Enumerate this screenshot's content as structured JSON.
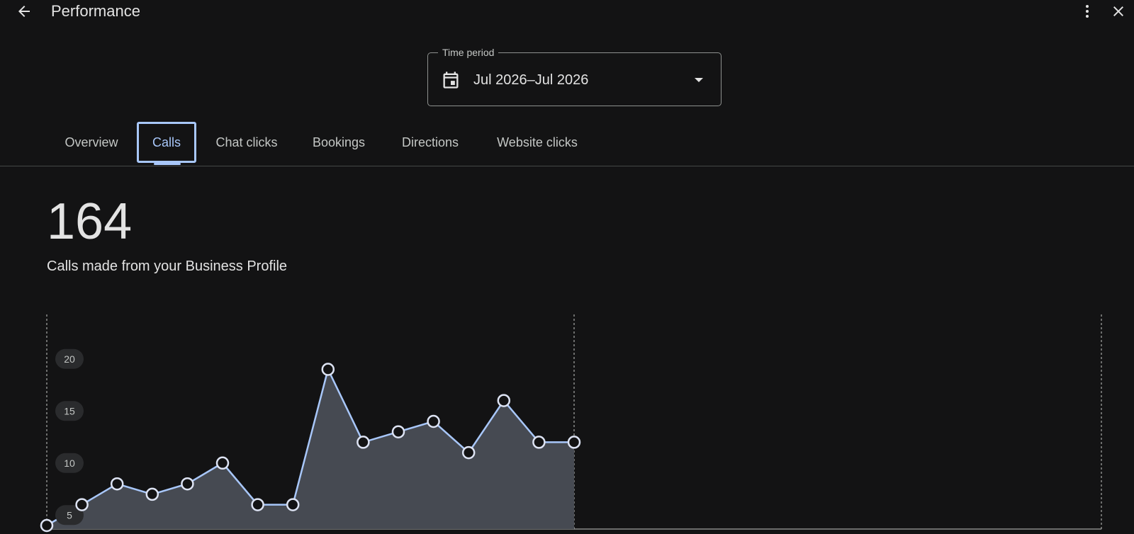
{
  "header": {
    "title": "Performance",
    "back_icon": "arrow-back-icon",
    "more_icon": "more-vert-icon",
    "close_icon": "close-icon"
  },
  "time_period": {
    "label": "Time period",
    "value": "Jul 2026–Jul 2026",
    "icon": "calendar-icon"
  },
  "tabs": [
    {
      "label": "Overview",
      "active": false
    },
    {
      "label": "Calls",
      "active": true
    },
    {
      "label": "Chat clicks",
      "active": false
    },
    {
      "label": "Bookings",
      "active": false
    },
    {
      "label": "Directions",
      "active": false
    },
    {
      "label": "Website clicks",
      "active": false
    }
  ],
  "metric": {
    "count": "164",
    "description": "Calls made from your Business Profile"
  },
  "colors": {
    "background": "#131314",
    "accent": "#a8c7fa",
    "area_fill": "#464a52",
    "text": "#e3e3e3"
  },
  "chart_data": {
    "type": "area",
    "x": [
      1,
      2,
      3,
      4,
      5,
      6,
      7,
      8,
      9,
      10,
      11,
      12,
      13,
      14,
      15,
      16
    ],
    "values": [
      4,
      6,
      8,
      7,
      8,
      10,
      6,
      6,
      19,
      12,
      13,
      14,
      11,
      16,
      12,
      12
    ],
    "yticks": [
      "20",
      "15",
      "10",
      "5"
    ],
    "ylim": [
      0,
      20
    ],
    "grid": false,
    "title": "",
    "xlabel": "",
    "ylabel": ""
  }
}
